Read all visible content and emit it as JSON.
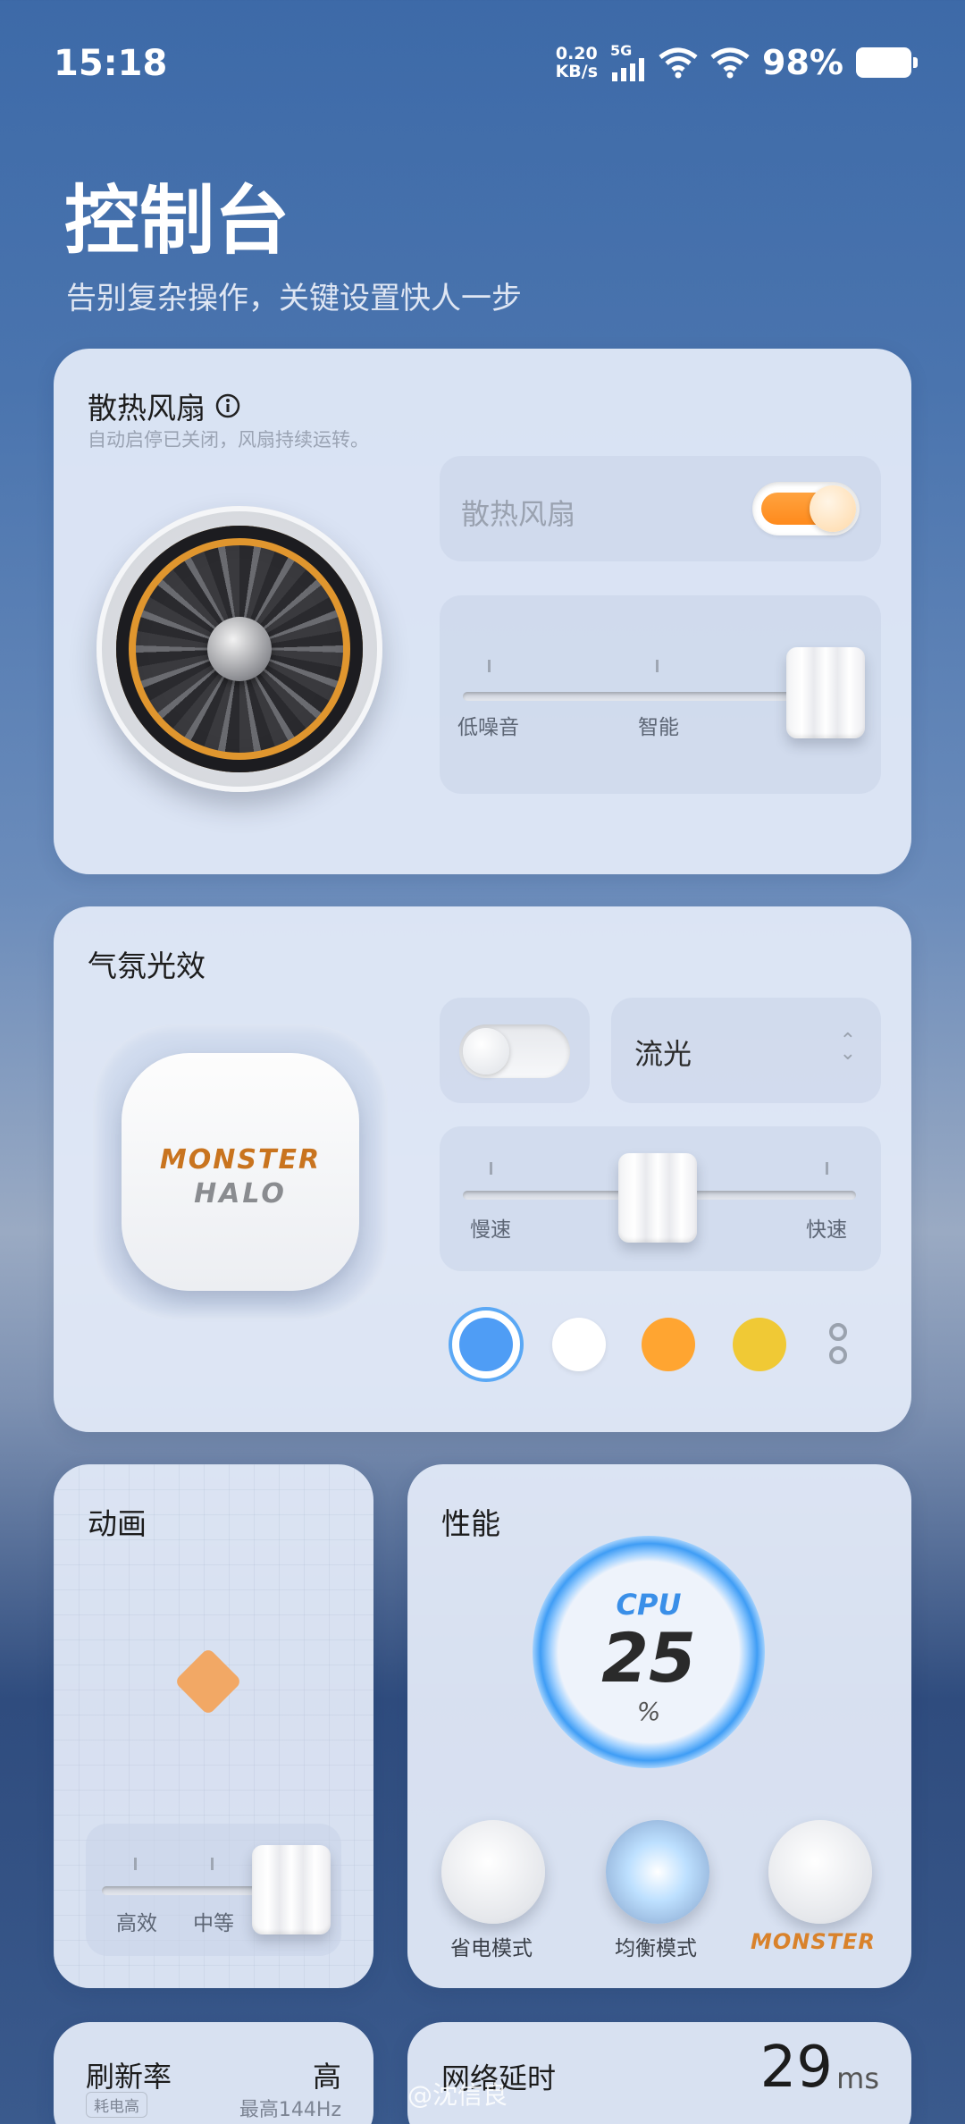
{
  "status_bar": {
    "time": "15:18",
    "speed_value": "0.20",
    "speed_unit": "KB/s",
    "network": "5G",
    "battery_percent": "98%"
  },
  "header": {
    "title": "控制台",
    "subtitle": "告别复杂操作，关键设置快人一步"
  },
  "fan_card": {
    "title": "散热风扇",
    "subtitle": "自动启停已关闭，风扇持续运转。",
    "toggle_label": "散热风扇",
    "toggle_on": true,
    "slider_labels": [
      "低噪音",
      "智能"
    ],
    "accent_color": "#ff8a1c"
  },
  "light_card": {
    "title": "气氛光效",
    "brand_line1": "MONSTER",
    "brand_line2": "HALO",
    "toggle_on": false,
    "effect_select": "流光",
    "speed_labels": [
      "慢速",
      "快速"
    ],
    "colors": [
      "#4f9df5",
      "#ffffff",
      "#ffa531",
      "#f0c935"
    ],
    "selected_color": "#4f9df5"
  },
  "animation_card": {
    "title": "动画",
    "slider_labels": [
      "高效",
      "中等"
    ]
  },
  "performance_card": {
    "title": "性能",
    "gauge_label": "CPU",
    "gauge_value": "25",
    "gauge_unit": "%",
    "modes": [
      "省电模式",
      "均衡模式",
      "MONSTER"
    ],
    "active_mode": "均衡模式"
  },
  "refresh_card": {
    "title": "刷新率",
    "value": "高",
    "tag": "耗电高",
    "detail": "最高144Hz"
  },
  "latency_card": {
    "title": "网络延时",
    "value": "29",
    "unit": "ms"
  },
  "watermark": "@沈信良"
}
